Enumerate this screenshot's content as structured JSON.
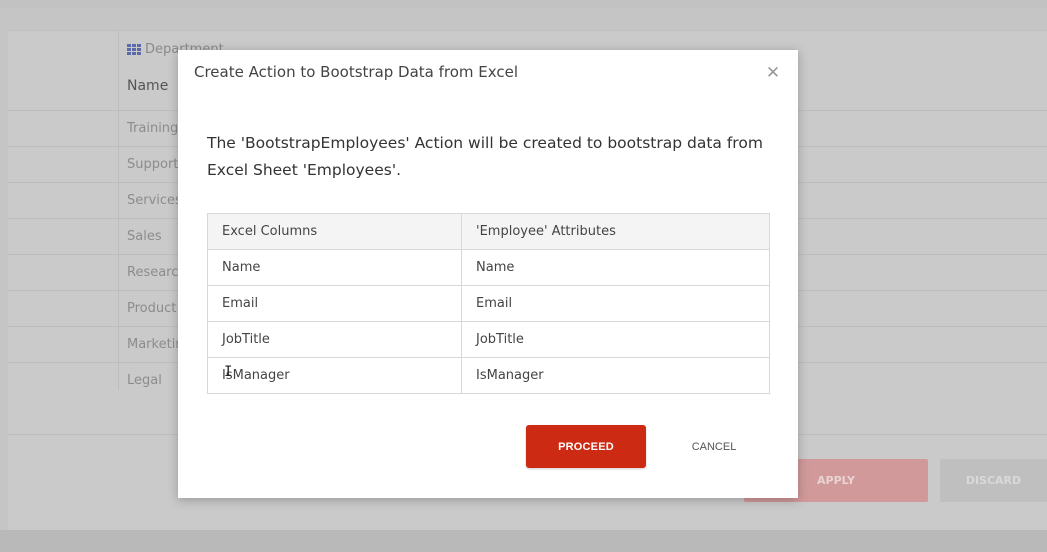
{
  "background": {
    "department_label": "Department",
    "column_header": "Name",
    "rows": [
      "Training",
      "Support",
      "Services",
      "Sales",
      "Research",
      "Product",
      "Marketing",
      "Legal"
    ],
    "apply_label": "APPLY",
    "discard_label": "DISCARD"
  },
  "modal": {
    "title": "Create Action to Bootstrap Data from Excel",
    "close_symbol": "✕",
    "message": "The 'BootstrapEmployees' Action will be created to bootstrap data from Excel Sheet 'Employees'.",
    "table": {
      "headers": [
        "Excel Columns",
        "'Employee' Attributes"
      ],
      "rows": [
        [
          "Name",
          "Name"
        ],
        [
          "Email",
          "Email"
        ],
        [
          "JobTitle",
          "JobTitle"
        ],
        [
          "IsManager",
          "IsManager"
        ]
      ]
    },
    "proceed_label": "PROCEED",
    "cancel_label": "CANCEL"
  },
  "colors": {
    "proceed": "#cc2a12",
    "overlay": "#c5c5c5"
  },
  "icons": {
    "close": "close-icon",
    "department": "grid-icon"
  }
}
